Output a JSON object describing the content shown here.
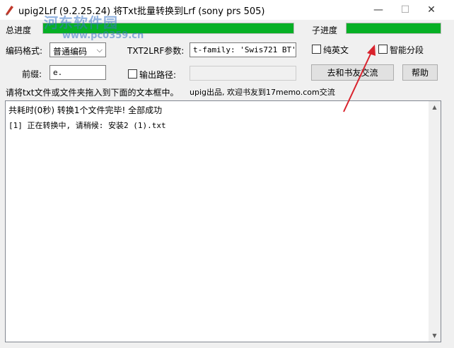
{
  "window": {
    "title": "upig2Lrf (9.2.25.24) 将Txt批量转换到Lrf (sony prs 505)",
    "minimize_symbol": "—",
    "maximize_symbol": "☐",
    "close_symbol": "✕"
  },
  "watermark": {
    "text": "河东软件园",
    "url": "www.pc0359.cn"
  },
  "progress": {
    "total_label": "总进度",
    "total_value": 1.0,
    "sub_label": "子进度",
    "sub_value": 1.0,
    "color": "#06b025"
  },
  "form": {
    "encoding_label": "编码格式:",
    "encoding_value": "普通编码",
    "txt2lrf_label": "TXT2LRF参数:",
    "txt2lrf_value": "t-family: 'Swis721 BT'}\"",
    "pure_english_label": "纯英文",
    "smart_split_label": "智能分段",
    "prefix_label": "前缀:",
    "prefix_value": "e.",
    "output_path_label": "输出路径:",
    "output_path_value": "",
    "forum_button": "去和书友交流",
    "help_button": "帮助"
  },
  "info": {
    "instruction": "请将txt文件或文件夹拖入到下面的文本框中。",
    "credits": "upig出品, 欢迎书友到17memo.com交流"
  },
  "log": {
    "lines": [
      "共耗时(0秒) 转换1个文件完毕! 全部成功",
      "[1]  正在转换中, 请稍候: 安装2 (1).txt"
    ]
  },
  "annotation": {
    "color": "#d9232d"
  }
}
